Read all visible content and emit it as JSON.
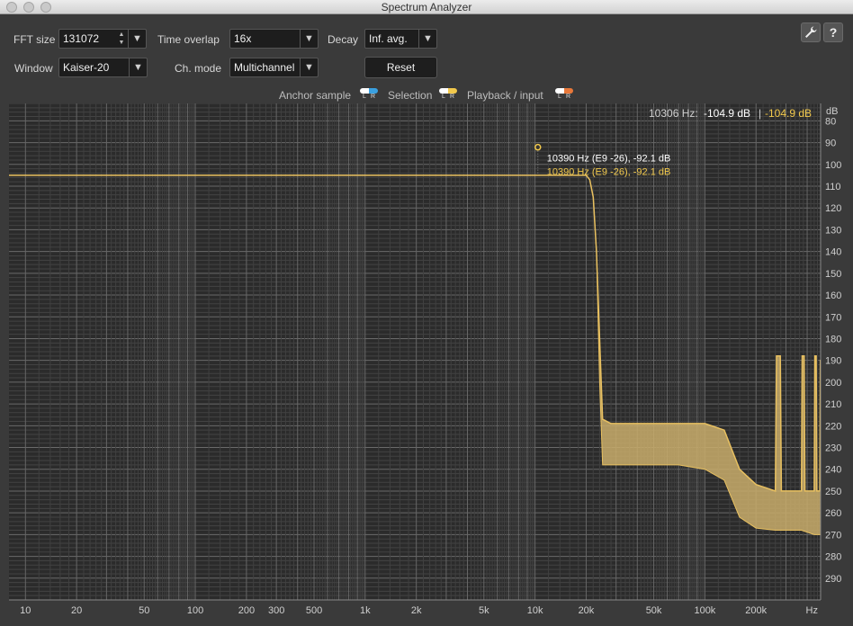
{
  "window": {
    "title": "Spectrum Analyzer"
  },
  "controls": {
    "fft_size_label": "FFT size",
    "fft_size_value": "131072",
    "time_overlap_label": "Time overlap",
    "time_overlap_value": "16x",
    "decay_label": "Decay",
    "decay_value": "Inf. avg.",
    "window_label": "Window",
    "window_value": "Kaiser-20",
    "ch_mode_label": "Ch. mode",
    "ch_mode_value": "Multichannel",
    "reset_label": "Reset",
    "settings_icon": "wrench-icon",
    "help_icon": "help-icon",
    "help_glyph": "?"
  },
  "legend": {
    "anchor_label": "Anchor sample",
    "selection_label": "Selection",
    "playback_label": "Playback / input",
    "l_text": "L",
    "r_text": "R",
    "anchor_colors": [
      "#ffffff",
      "#3aa0e0"
    ],
    "selection_colors": [
      "#ffffff",
      "#f2c94c"
    ],
    "playback_colors": [
      "#ffffff",
      "#e8783a"
    ]
  },
  "readout": {
    "freq": "10306 Hz:",
    "value_white": "-104.9 dB",
    "separator": "|",
    "value_yellow": "-104.9 dB"
  },
  "marker": {
    "freq_hz": 10390,
    "db": -92.1,
    "label_white": "10390 Hz (E9 -26), -92.1 dB",
    "label_yellow": "10390 Hz (E9 -26), -92.1 dB"
  },
  "chart_data": {
    "type": "line",
    "title": "",
    "xlabel": "Hz",
    "ylabel": "dB",
    "x_scale": "log",
    "xlim": [
      8,
      480000
    ],
    "ylim": [
      -300,
      -72
    ],
    "x_tick_labels": [
      {
        "v": 10,
        "t": "10"
      },
      {
        "v": 20,
        "t": "20"
      },
      {
        "v": 50,
        "t": "50"
      },
      {
        "v": 100,
        "t": "100"
      },
      {
        "v": 200,
        "t": "200"
      },
      {
        "v": 300,
        "t": "300"
      },
      {
        "v": 500,
        "t": "500"
      },
      {
        "v": 1000,
        "t": "1k"
      },
      {
        "v": 2000,
        "t": "2k"
      },
      {
        "v": 5000,
        "t": "5k"
      },
      {
        "v": 10000,
        "t": "10k"
      },
      {
        "v": 20000,
        "t": "20k"
      },
      {
        "v": 50000,
        "t": "50k"
      },
      {
        "v": 100000,
        "t": "100k"
      },
      {
        "v": 200000,
        "t": "200k"
      }
    ],
    "y_ticks": [
      -80,
      -90,
      -100,
      -110,
      -120,
      -130,
      -140,
      -150,
      -160,
      -170,
      -180,
      -190,
      -200,
      -210,
      -220,
      -230,
      -240,
      -250,
      -260,
      -270,
      -280,
      -290
    ],
    "y_tick_labels": [
      "80",
      "90",
      "100",
      "110",
      "120",
      "130",
      "140",
      "150",
      "160",
      "170",
      "180",
      "190",
      "200",
      "210",
      "220",
      "230",
      "240",
      "250",
      "260",
      "270",
      "280",
      "290"
    ],
    "grid": true,
    "series": [
      {
        "color": "#e8c060",
        "fill": "#c9ad6b",
        "upper": [
          [
            8,
            -105
          ],
          [
            10000,
            -105
          ],
          [
            20000,
            -105
          ],
          [
            21000,
            -107
          ],
          [
            22000,
            -115
          ],
          [
            23000,
            -140
          ],
          [
            24000,
            -180
          ],
          [
            25000,
            -217
          ],
          [
            28000,
            -219
          ],
          [
            40000,
            -219
          ],
          [
            60000,
            -219
          ],
          [
            100000,
            -219
          ],
          [
            130000,
            -222
          ],
          [
            160000,
            -240
          ],
          [
            200000,
            -247
          ],
          [
            260000,
            -250
          ],
          [
            264000,
            -188
          ],
          [
            278000,
            -188
          ],
          [
            282000,
            -250
          ],
          [
            370000,
            -250
          ],
          [
            374000,
            -188
          ],
          [
            384000,
            -188
          ],
          [
            388000,
            -250
          ],
          [
            440000,
            -250
          ],
          [
            444000,
            -188
          ],
          [
            452000,
            -188
          ],
          [
            456000,
            -250
          ],
          [
            475000,
            -250
          ],
          [
            478000,
            -190
          ],
          [
            480000,
            -190
          ]
        ],
        "lower": [
          [
            8,
            -105
          ],
          [
            20000,
            -105
          ],
          [
            21000,
            -107
          ],
          [
            22000,
            -115
          ],
          [
            23000,
            -140
          ],
          [
            24000,
            -200
          ],
          [
            25000,
            -238
          ],
          [
            40000,
            -238
          ],
          [
            70000,
            -238
          ],
          [
            100000,
            -240
          ],
          [
            130000,
            -245
          ],
          [
            160000,
            -262
          ],
          [
            200000,
            -267
          ],
          [
            260000,
            -268
          ],
          [
            264000,
            -268
          ],
          [
            370000,
            -268
          ],
          [
            440000,
            -270
          ],
          [
            480000,
            -270
          ]
        ]
      }
    ]
  }
}
